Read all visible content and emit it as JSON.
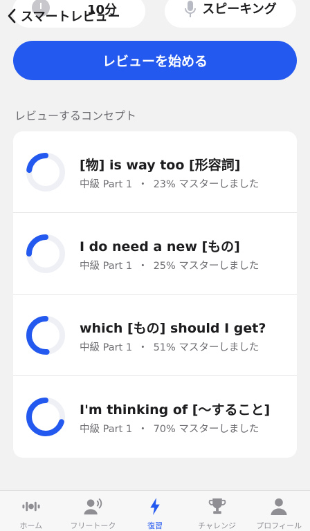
{
  "header": {
    "back_label": "スマートレビュー",
    "time_label": "10分",
    "speaking_label": "スピーキング"
  },
  "start_button": "レビューを始める",
  "section_title": "レビューするコンセプト",
  "concepts": [
    {
      "title": "[物] is way too [形容詞]",
      "level": "中級 Part 1",
      "mastery": 23,
      "mastery_text": "23% マスターしました"
    },
    {
      "title": "I do need a new [もの]",
      "level": "中級 Part 1",
      "mastery": 25,
      "mastery_text": "25% マスターしました"
    },
    {
      "title": "which [もの] should I get?",
      "level": "中級 Part 1",
      "mastery": 51,
      "mastery_text": "51% マスターしました"
    },
    {
      "title": "I'm thinking of [〜すること]",
      "level": "中級 Part 1",
      "mastery": 70,
      "mastery_text": "70% マスターしました"
    }
  ],
  "separator": "・",
  "tabs": [
    {
      "label": "ホーム",
      "icon": "waveform-icon"
    },
    {
      "label": "フリートーク",
      "icon": "speaking-person-icon"
    },
    {
      "label": "復習",
      "icon": "lightning-icon",
      "active": true
    },
    {
      "label": "チャレンジ",
      "icon": "trophy-icon"
    },
    {
      "label": "プロフィール",
      "icon": "person-icon"
    }
  ],
  "colors": {
    "accent": "#2459ef",
    "ring_track": "#eef0f5",
    "tab_inactive": "#8e8e93"
  }
}
